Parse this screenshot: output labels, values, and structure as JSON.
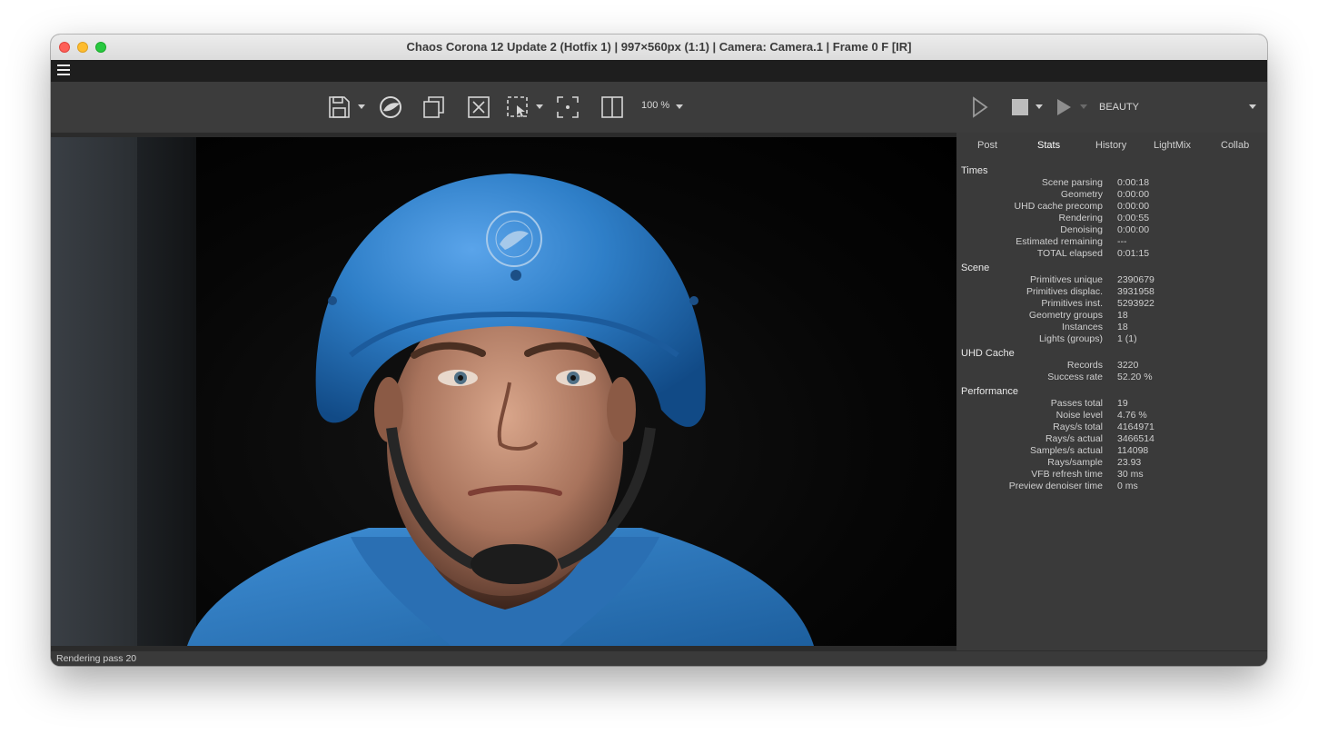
{
  "window": {
    "title": "Chaos Corona 12 Update 2 (Hotfix 1) | 997×560px (1:1) | Camera: Camera.1 | Frame 0 F [IR]"
  },
  "toolbar": {
    "zoom": "100 %",
    "icons": [
      "save-icon",
      "corona-logo-icon",
      "copy-icon",
      "clear-icon",
      "region-select-icon",
      "focus-icon",
      "split-view-icon"
    ]
  },
  "render_controls": {
    "channel": "BEAUTY"
  },
  "sidebar": {
    "tabs": [
      "Post",
      "Stats",
      "History",
      "LightMix",
      "Collab"
    ],
    "active_tab": "Stats",
    "groups": [
      {
        "title": "Times",
        "rows": [
          {
            "label": "Scene parsing",
            "value": "0:00:18"
          },
          {
            "label": "Geometry",
            "value": "0:00:00"
          },
          {
            "label": "UHD cache precomp",
            "value": "0:00:00"
          },
          {
            "label": "Rendering",
            "value": "0:00:55"
          },
          {
            "label": "Denoising",
            "value": "0:00:00"
          },
          {
            "label": "Estimated remaining",
            "value": "---"
          },
          {
            "label": "TOTAL elapsed",
            "value": "0:01:15"
          }
        ]
      },
      {
        "title": "Scene",
        "rows": [
          {
            "label": "Primitives unique",
            "value": "2390679"
          },
          {
            "label": "Primitives displac.",
            "value": "3931958"
          },
          {
            "label": "Primitives inst.",
            "value": "5293922"
          },
          {
            "label": "Geometry groups",
            "value": "18"
          },
          {
            "label": "Instances",
            "value": "18"
          },
          {
            "label": "Lights (groups)",
            "value": "1 (1)"
          }
        ]
      },
      {
        "title": "UHD Cache",
        "rows": [
          {
            "label": "Records",
            "value": "3220"
          },
          {
            "label": "Success rate",
            "value": "52.20 %"
          }
        ]
      },
      {
        "title": "Performance",
        "rows": [
          {
            "label": "Passes total",
            "value": "19"
          },
          {
            "label": "Noise level",
            "value": "4.76 %"
          },
          {
            "label": "Rays/s total",
            "value": "4164971"
          },
          {
            "label": "Rays/s actual",
            "value": "3466514"
          },
          {
            "label": "Samples/s actual",
            "value": "114098"
          },
          {
            "label": "Rays/sample",
            "value": "23.93"
          },
          {
            "label": "VFB refresh time",
            "value": "30 ms"
          },
          {
            "label": "Preview denoiser time",
            "value": "0 ms"
          }
        ]
      }
    ]
  },
  "status": {
    "text": "Rendering pass 20"
  },
  "colors": {
    "helmet": "#2f7fc8",
    "background": "#3a3a3a",
    "menubar": "#1e1e1e"
  }
}
